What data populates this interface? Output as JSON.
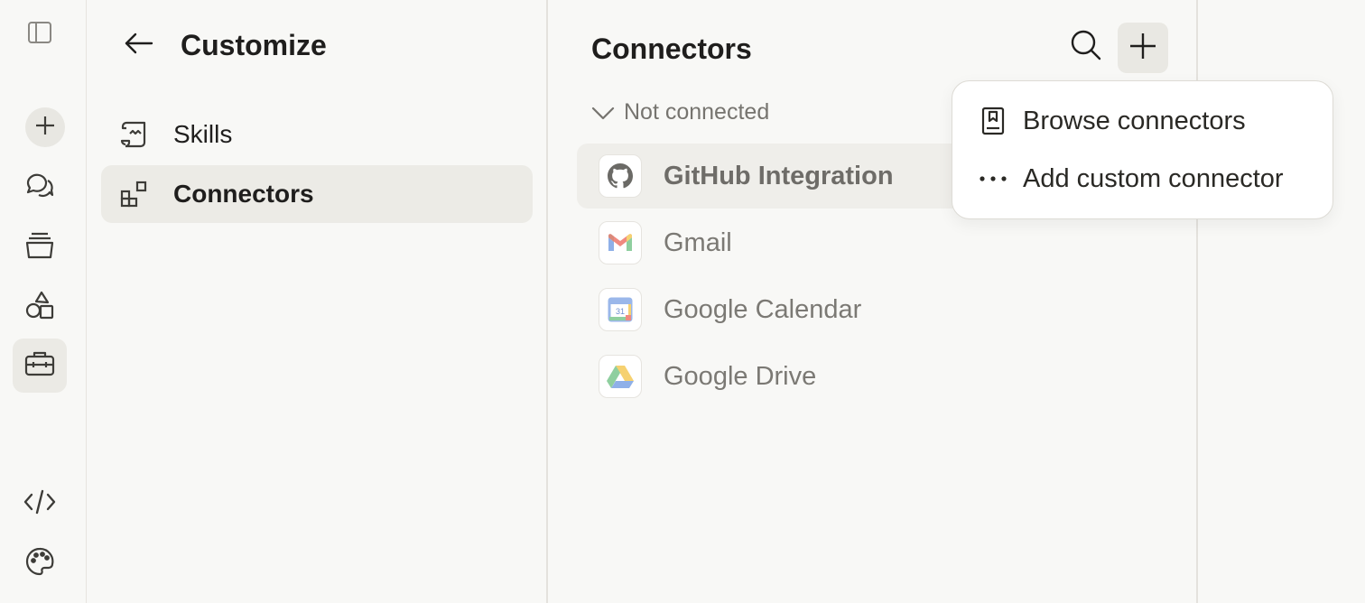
{
  "rail": {
    "items": [
      {
        "name": "sidebar-toggle",
        "icon": "sidebar-toggle-icon"
      },
      {
        "name": "new-chat",
        "icon": "plus-icon"
      },
      {
        "name": "chats",
        "icon": "chat-bubbles-icon"
      },
      {
        "name": "projects",
        "icon": "stack-icon"
      },
      {
        "name": "artifacts",
        "icon": "shapes-icon"
      },
      {
        "name": "customize",
        "icon": "briefcase-icon",
        "active": true
      },
      {
        "name": "code",
        "icon": "code-icon"
      },
      {
        "name": "theme",
        "icon": "palette-icon"
      }
    ]
  },
  "left_panel": {
    "title": "Customize",
    "nav": [
      {
        "label": "Skills",
        "icon": "scroll-icon",
        "active": false
      },
      {
        "label": "Connectors",
        "icon": "blocks-icon",
        "active": true
      }
    ]
  },
  "main": {
    "title": "Connectors",
    "section": "Not connected",
    "connectors": [
      {
        "name": "GitHub Integration",
        "icon": "github-icon"
      },
      {
        "name": "Gmail",
        "icon": "gmail-icon"
      },
      {
        "name": "Google Calendar",
        "icon": "google-calendar-icon"
      },
      {
        "name": "Google Drive",
        "icon": "google-drive-icon"
      }
    ]
  },
  "add_menu": {
    "items": [
      {
        "label": "Browse connectors",
        "icon": "book-bookmark-icon"
      },
      {
        "label": "Add custom connector",
        "icon": "more-dots-icon"
      }
    ]
  },
  "colors": {
    "background": "#f8f8f6",
    "active_item": "#ecebe6",
    "text": "#1f1e1d",
    "muted_text": "#7b7974"
  }
}
